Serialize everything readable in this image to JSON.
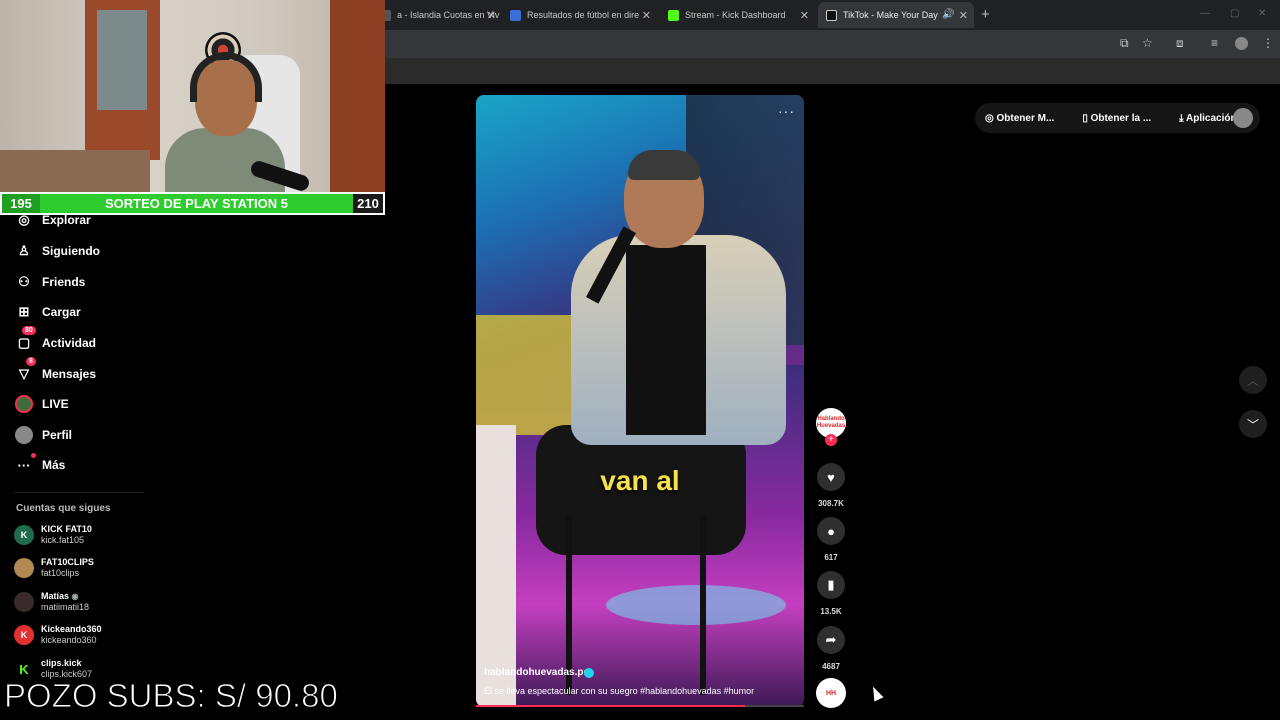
{
  "browser": {
    "tabs": [
      {
        "title": "a - Islandia Cuotas en Viv",
        "color": "#555555"
      },
      {
        "title": "Resultados de fútbol en directo",
        "color": "#3b6fd8"
      },
      {
        "title": "Stream - Kick Dashboard",
        "color": "#53fc18"
      },
      {
        "title": "TikTok - Make Your Day",
        "color": "#111111"
      }
    ],
    "new_tab": "+",
    "close": "✕"
  },
  "overlay": {
    "sorteo_left": "195",
    "sorteo_title": "SORTEO DE PLAY STATION 5",
    "sorteo_right": "210",
    "pozo": "POZO SUBS: S/ 90.80"
  },
  "sidebar": {
    "items": [
      {
        "label": "Explorar",
        "icon": "compass-icon",
        "glyph": "◎"
      },
      {
        "label": "Siguiendo",
        "icon": "user-follow-icon",
        "glyph": "👤"
      },
      {
        "label": "Friends",
        "icon": "friends-icon",
        "glyph": "👥"
      },
      {
        "label": "Cargar",
        "icon": "upload-icon",
        "glyph": "⊞"
      },
      {
        "label": "Actividad",
        "icon": "activity-icon",
        "glyph": "▢",
        "badge": "80"
      },
      {
        "label": "Mensajes",
        "icon": "messages-icon",
        "glyph": "▽",
        "badge": "8"
      },
      {
        "label": "LIVE",
        "icon": "live-icon",
        "glyph": "●"
      },
      {
        "label": "Perfil",
        "icon": "profile-icon",
        "glyph": "●"
      },
      {
        "label": "Más",
        "icon": "more-icon",
        "glyph": "···"
      }
    ],
    "following_header": "Cuentas que sigues",
    "accounts": [
      {
        "name": "KICK FAT10",
        "handle": "kick.fat105",
        "initial": "K",
        "color": "#1f6b4a"
      },
      {
        "name": "FAT10CLIPS",
        "handle": "fat10clips",
        "initial": "",
        "color": "#b08a50"
      },
      {
        "name": "Matías",
        "handle": "matiimatii18",
        "initial": "",
        "color": "#3a2a2a"
      },
      {
        "name": "Kickeando360",
        "handle": "kickeando360",
        "initial": "K",
        "color": "#e03030"
      },
      {
        "name": "clips.kick",
        "handle": "clips.kick607",
        "initial": "K",
        "color": "#000000"
      }
    ]
  },
  "video": {
    "caption": "van al",
    "username": "hablandohuevadas.pe",
    "description": "Él se lleva espectacular con su suegro #hablandohuevadas #humor",
    "progress": 0.82,
    "more": "···"
  },
  "actions": {
    "creator_avatar": "Hablando Huevadas",
    "likes": "308.7K",
    "comments": "617",
    "saves": "13.5K",
    "shares": "4687"
  },
  "topbar": {
    "get_m": "Obtener M...",
    "get_app": "Obtener la ...",
    "app": "Aplicación ..."
  }
}
